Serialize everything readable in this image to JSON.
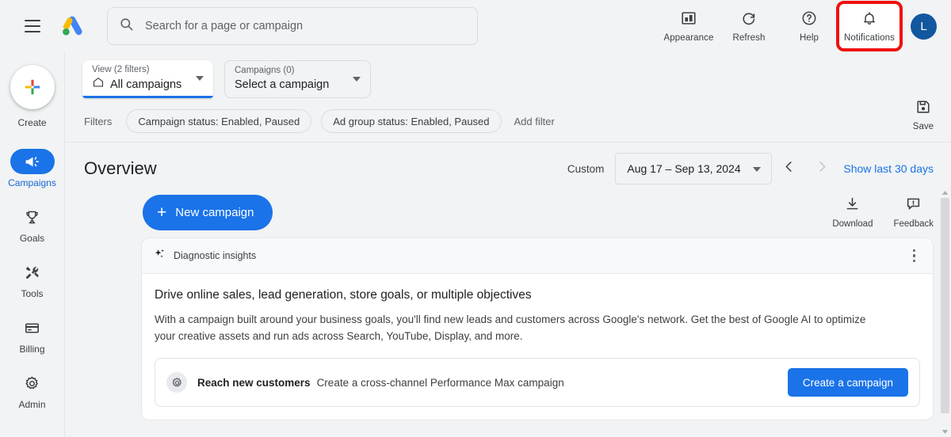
{
  "topbar": {
    "menu_icon": "hamburger-menu-icon",
    "logo": "google-ads-logo",
    "search": {
      "placeholder": "Search for a page or campaign",
      "value": "",
      "icon": "search-icon"
    },
    "actions": [
      {
        "label": "Appearance",
        "icon": "appearance-icon",
        "highlighted": false
      },
      {
        "label": "Refresh",
        "icon": "refresh-icon",
        "highlighted": false
      },
      {
        "label": "Help",
        "icon": "help-icon",
        "highlighted": false
      },
      {
        "label": "Notifications",
        "icon": "bell-icon",
        "highlighted": true
      }
    ],
    "avatar_initial": "L"
  },
  "sidebar": {
    "create": {
      "label": "Create",
      "icon": "plus-icon"
    },
    "items": [
      {
        "label": "Campaigns",
        "icon": "campaigns-megaphone-icon",
        "active": true
      },
      {
        "label": "Goals",
        "icon": "goals-trophy-icon",
        "active": false
      },
      {
        "label": "Tools",
        "icon": "tools-wrench-icon",
        "active": false
      },
      {
        "label": "Billing",
        "icon": "billing-card-icon",
        "active": false
      },
      {
        "label": "Admin",
        "icon": "admin-gear-icon",
        "active": false
      }
    ]
  },
  "selectors": {
    "view": {
      "sub": "View (2 filters)",
      "main": "All campaigns",
      "icon": "home-icon"
    },
    "campaign": {
      "sub": "Campaigns (0)",
      "main": "Select a campaign"
    }
  },
  "filters": {
    "label": "Filters",
    "chips": [
      "Campaign status: Enabled, Paused",
      "Ad group status: Enabled, Paused"
    ],
    "add_filter": "Add filter",
    "save": {
      "label": "Save",
      "icon": "save-disk-icon"
    }
  },
  "page": {
    "title": "Overview",
    "date_range": {
      "mode_label": "Custom",
      "value": "Aug 17 – Sep 13, 2024",
      "prev_icon": "chevron-left-icon",
      "next_icon": "chevron-right-icon",
      "shortcut": "Show last 30 days"
    }
  },
  "actions": {
    "new_campaign": "New campaign",
    "download": {
      "label": "Download",
      "icon": "download-icon"
    },
    "feedback": {
      "label": "Feedback",
      "icon": "feedback-icon"
    }
  },
  "card": {
    "header": {
      "title": "Diagnostic insights",
      "icon": "sparkle-icon",
      "menu_icon": "kebab-menu-icon"
    },
    "heading": "Drive online sales, lead generation, store goals, or multiple objectives",
    "body": "With a campaign built around your business goals, you'll find new leads and customers across Google's network. Get the best of Google AI to optimize your creative assets and run ads across Search, YouTube, Display, and more.",
    "panel": {
      "icon": "settings-gear-icon",
      "strong": "Reach new customers",
      "text": "Create a cross-channel Performance Max campaign",
      "button": "Create a campaign"
    }
  },
  "colors": {
    "accent_blue": "#1a73e8",
    "link_blue": "#1967d2",
    "highlight_red": "#ee1111",
    "avatar_blue": "#13579e",
    "page_bg": "#f1f3f4",
    "card_bg": "#ffffff",
    "card_head_bg": "#f8f9fa",
    "text_primary": "#202124",
    "text_secondary": "#5f6368"
  },
  "scrollbar": {
    "up_icon": "scroll-up-arrow-icon",
    "down_icon": "scroll-down-arrow-icon"
  }
}
